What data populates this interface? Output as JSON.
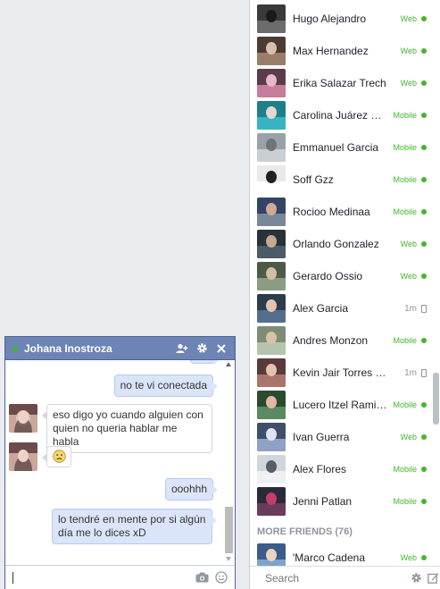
{
  "chat": {
    "title": "Johana Inostroza",
    "messages": [
      {
        "from": "me",
        "text": "no te vi conectada"
      },
      {
        "from": "them",
        "text": "eso digo yo cuando alguien con quien no queria hablar me habla"
      },
      {
        "from": "them",
        "text": "🙁"
      },
      {
        "from": "me",
        "text": "ooohhh"
      },
      {
        "from": "me",
        "text": "lo tendré en mente por si algún día me lo dices xD"
      }
    ],
    "input_value": ""
  },
  "sidebar": {
    "friends": [
      {
        "name": "Hugo Alejandro",
        "status": "Web",
        "kind": "web"
      },
      {
        "name": "Max Hernandez",
        "status": "Web",
        "kind": "web"
      },
      {
        "name": "Erika Salazar Trech",
        "status": "Web",
        "kind": "web"
      },
      {
        "name": "Carolina Juárez Sandoval",
        "status": "Mobile",
        "kind": "mobile"
      },
      {
        "name": "Emmanuel Garcia",
        "status": "Mobile",
        "kind": "mobile"
      },
      {
        "name": "Soff Gzz",
        "status": "Mobile",
        "kind": "mobile"
      },
      {
        "name": "Rocioo Medinaa",
        "status": "Mobile",
        "kind": "mobile"
      },
      {
        "name": "Orlando Gonzalez",
        "status": "Web",
        "kind": "web"
      },
      {
        "name": "Gerardo Ossio",
        "status": "Web",
        "kind": "web"
      },
      {
        "name": "Alex Garcia",
        "status": "1m",
        "kind": "time"
      },
      {
        "name": "Andres Monzon",
        "status": "Mobile",
        "kind": "mobile"
      },
      {
        "name": "Kevin Jair Torres Martinez",
        "status": "1m",
        "kind": "time"
      },
      {
        "name": "Lucero Itzel Ramirez",
        "status": "Mobile",
        "kind": "mobile"
      },
      {
        "name": "Ivan Guerra",
        "status": "Web",
        "kind": "web"
      },
      {
        "name": "Alex Flores",
        "status": "Mobile",
        "kind": "mobile"
      },
      {
        "name": "Jenni Patlan",
        "status": "Mobile",
        "kind": "mobile"
      }
    ],
    "more_friends_label": "MORE FRIENDS (76)",
    "more_friends": [
      {
        "name": "'Marco Cadena",
        "status": "Web",
        "kind": "web"
      }
    ],
    "search_placeholder": "Search"
  },
  "colors": {
    "header_blue": "#6d84b4",
    "online_green": "#42b72a",
    "my_bubble": "#dbe5f9"
  }
}
